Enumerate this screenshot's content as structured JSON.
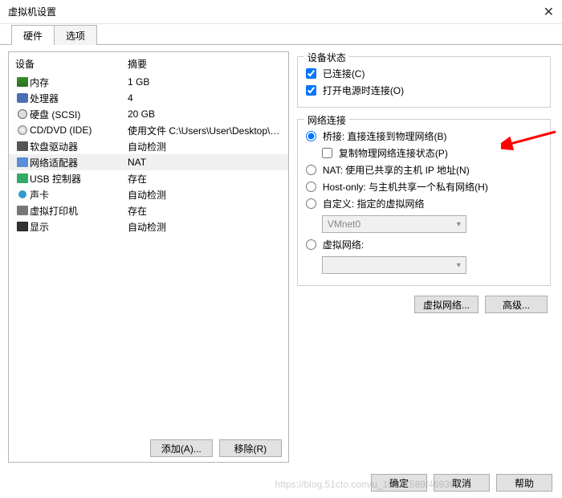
{
  "window": {
    "title": "虚拟机设置"
  },
  "tabs": {
    "hardware": "硬件",
    "options": "选项"
  },
  "headers": {
    "device": "设备",
    "summary": "摘要"
  },
  "devices": [
    {
      "icon": "ic-mem",
      "name": "内存",
      "summary": "1 GB",
      "sel": false
    },
    {
      "icon": "ic-cpu",
      "name": "处理器",
      "summary": "4",
      "sel": false
    },
    {
      "icon": "ic-disk",
      "name": "硬盘 (SCSI)",
      "summary": "20 GB",
      "sel": false
    },
    {
      "icon": "ic-cd",
      "name": "CD/DVD (IDE)",
      "summary": "使用文件 C:\\Users\\User\\Desktop\\C...",
      "sel": false
    },
    {
      "icon": "ic-floppy",
      "name": "软盘驱动器",
      "summary": "自动检测",
      "sel": false
    },
    {
      "icon": "ic-net",
      "name": "网络适配器",
      "summary": "NAT",
      "sel": true
    },
    {
      "icon": "ic-usb",
      "name": "USB 控制器",
      "summary": "存在",
      "sel": false
    },
    {
      "icon": "ic-audio",
      "name": "声卡",
      "summary": "自动检测",
      "sel": false
    },
    {
      "icon": "ic-printer",
      "name": "虚拟打印机",
      "summary": "存在",
      "sel": false
    },
    {
      "icon": "ic-display",
      "name": "显示",
      "summary": "自动检测",
      "sel": false
    }
  ],
  "left_buttons": {
    "add": "添加(A)...",
    "remove": "移除(R)"
  },
  "device_state": {
    "legend": "设备状态",
    "connected": "已连接(C)",
    "connect_at_power_on": "打开电源时连接(O)"
  },
  "network": {
    "legend": "网络连接",
    "bridged": "桥接: 直接连接到物理网络(B)",
    "replicate": "复制物理网络连接状态(P)",
    "nat": "NAT: 使用已共享的主机 IP 地址(N)",
    "hostonly": "Host-only: 与主机共享一个私有网络(H)",
    "custom": "自定义: 指定的虚拟网络",
    "custom_value": "VMnet0",
    "virtual": "虚拟网络:",
    "virtual_value": ""
  },
  "right_buttons": {
    "virtnet": "虚拟网络...",
    "advanced": "高级..."
  },
  "dialog_buttons": {
    "ok": "确定",
    "cancel": "取消",
    "help": "帮助"
  },
  "watermark": "https://blog.51cto.com/u_15127589/4693997"
}
